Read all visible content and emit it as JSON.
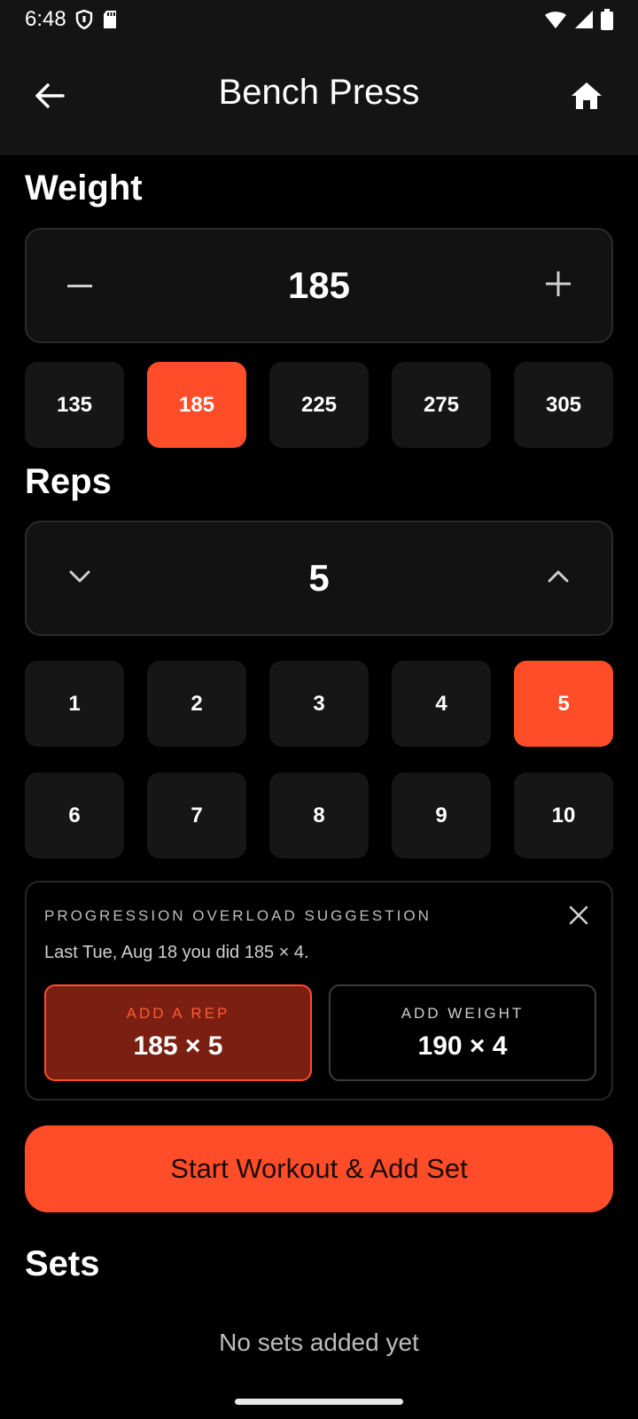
{
  "status_bar": {
    "time": "6:48",
    "icons_left": [
      "shield-icon",
      "sd-card-icon"
    ],
    "icons_right": [
      "wifi-icon",
      "signal-icon",
      "battery-icon"
    ]
  },
  "app_bar": {
    "title": "Bench Press",
    "back_icon": "arrow-back-icon",
    "home_icon": "home-icon"
  },
  "weight": {
    "title": "Weight",
    "value": "185",
    "decrement_icon": "minus-icon",
    "increment_icon": "plus-icon",
    "presets": [
      "135",
      "185",
      "225",
      "275",
      "305"
    ],
    "selected": "185"
  },
  "reps": {
    "title": "Reps",
    "value": "5",
    "decrement_icon": "chevron-down-icon",
    "increment_icon": "chevron-up-icon",
    "presets_row1": [
      "1",
      "2",
      "3",
      "4",
      "5"
    ],
    "presets_row2": [
      "6",
      "7",
      "8",
      "9",
      "10"
    ],
    "selected": "5"
  },
  "suggestion": {
    "label": "PROGRESSION OVERLOAD SUGGESTION",
    "text": "Last Tue, Aug 18 you did 185 × 4.",
    "close_icon": "close-icon",
    "add_rep": {
      "label": "ADD A REP",
      "value": "185 × 5"
    },
    "add_weight": {
      "label": "ADD WEIGHT",
      "value": "190 × 4"
    }
  },
  "cta": {
    "label": "Start Workout & Add Set"
  },
  "sets": {
    "title": "Sets",
    "empty_text": "No sets added yet"
  },
  "colors": {
    "accent": "#ff4d29",
    "background": "#000000",
    "card": "#161616",
    "app_bar": "#141414"
  }
}
